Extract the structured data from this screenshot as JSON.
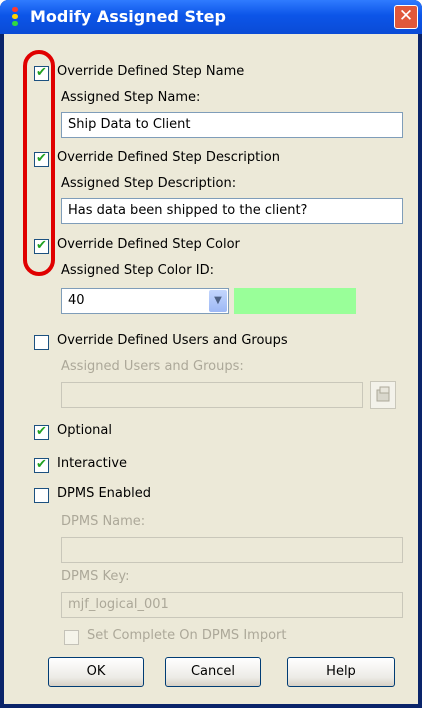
{
  "window": {
    "title": "Modify Assigned Step",
    "close_label": "✕"
  },
  "step_name": {
    "checkbox_label": "Override Defined Step Name",
    "checked": true,
    "field_label": "Assigned Step Name:",
    "value": "Ship Data to Client"
  },
  "step_description": {
    "checkbox_label": "Override Defined Step Description",
    "checked": true,
    "field_label": "Assigned Step Description:",
    "value": "Has data been shipped to the client?"
  },
  "step_color": {
    "checkbox_label": "Override Defined Step Color",
    "checked": true,
    "field_label": "Assigned Step Color ID:",
    "value": "40",
    "swatch_color": "#99ff99"
  },
  "users_groups": {
    "checkbox_label": "Override Defined Users and Groups",
    "checked": false,
    "field_label": "Assigned Users and Groups:",
    "value": ""
  },
  "optional": {
    "label": "Optional",
    "checked": true
  },
  "interactive": {
    "label": "Interactive",
    "checked": true
  },
  "dpms": {
    "checkbox_label": "DPMS Enabled",
    "checked": false,
    "name_label": "DPMS Name:",
    "name_value": "",
    "key_label": "DPMS Key:",
    "key_value": "mjf_logical_001",
    "set_complete_label": "Set Complete On DPMS Import",
    "set_complete_checked": false
  },
  "buttons": {
    "ok": "OK",
    "cancel": "Cancel",
    "help": "Help"
  },
  "colors": {
    "title_bar": "#0c55e8",
    "highlight": "#e00000",
    "dialog_bg": "#ece9d8"
  }
}
